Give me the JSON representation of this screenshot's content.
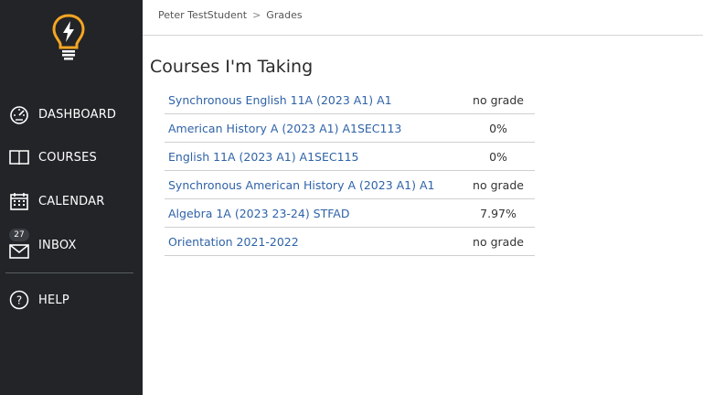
{
  "sidebar": {
    "items": [
      {
        "label": "DASHBOARD",
        "icon": "dashboard-icon"
      },
      {
        "label": "COURSES",
        "icon": "book-icon"
      },
      {
        "label": "CALENDAR",
        "icon": "calendar-icon"
      },
      {
        "label": "INBOX",
        "icon": "mail-icon",
        "badge": "27"
      },
      {
        "label": "HELP",
        "icon": "help-icon"
      }
    ],
    "logo_color": "#f5a623"
  },
  "breadcrumb": {
    "user": "Peter TestStudent",
    "separator": ">",
    "current": "Grades"
  },
  "page_title": "Courses I'm Taking",
  "courses": [
    {
      "name": "Synchronous English 11A (2023 A1) A1",
      "grade": "no grade"
    },
    {
      "name": "American History A (2023 A1) A1SEC113",
      "grade": "0%"
    },
    {
      "name": "English 11A (2023 A1) A1SEC115",
      "grade": "0%"
    },
    {
      "name": "Synchronous American History A (2023 A1) A1",
      "grade": "no grade"
    },
    {
      "name": "Algebra 1A (2023 23-24) STFAD",
      "grade": "7.97%"
    },
    {
      "name": "Orientation 2021-2022",
      "grade": "no grade"
    }
  ],
  "colors": {
    "sidebar_bg": "#222427",
    "link": "#2f63a8",
    "accent": "#f5a623"
  }
}
